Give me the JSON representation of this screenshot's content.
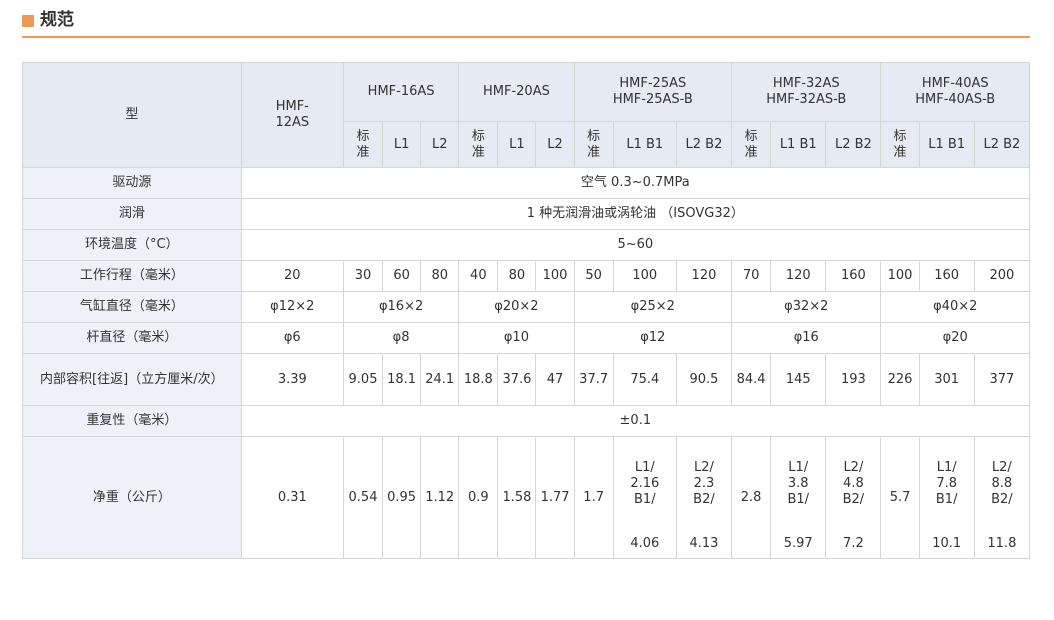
{
  "section": {
    "title": "规范"
  },
  "table": {
    "corner_label": "型",
    "models": [
      {
        "lines": [
          "HMF-",
          "12AS"
        ]
      },
      {
        "lines": [
          "HMF-16AS"
        ]
      },
      {
        "lines": [
          "HMF-20AS"
        ]
      },
      {
        "lines": [
          "HMF-25AS",
          "HMF-25AS-B"
        ]
      },
      {
        "lines": [
          "HMF-32AS",
          "HMF-32AS-B"
        ]
      },
      {
        "lines": [
          "HMF-40AS",
          "HMF-40AS-B"
        ]
      }
    ],
    "sub_headers": {
      "std": [
        "标",
        "准"
      ],
      "l1": "L1",
      "l2": "L2",
      "l1b1": "L1 B1",
      "l2b2": "L2 B2"
    },
    "rows": {
      "drive_source": {
        "label": "驱动源",
        "value": "空气 0.3~0.7MPa"
      },
      "lubrication": {
        "label": "润滑",
        "value": "1 种无润滑油或涡轮油 （ISOVG32）"
      },
      "ambient_temp": {
        "label": "环境温度（°C）",
        "value": "5~60"
      },
      "stroke": {
        "label": "工作行程（毫米）",
        "values": [
          "20",
          "30",
          "60",
          "80",
          "40",
          "80",
          "100",
          "50",
          "100",
          "120",
          "70",
          "120",
          "160",
          "100",
          "160",
          "200"
        ]
      },
      "bore": {
        "label": "气缸直径（毫米）",
        "values": [
          "φ12×2",
          "φ16×2",
          "φ20×2",
          "φ25×2",
          "φ32×2",
          "φ40×2"
        ]
      },
      "rod": {
        "label": "杆直径（毫米）",
        "values": [
          "φ6",
          "φ8",
          "φ10",
          "φ12",
          "φ16",
          "φ20"
        ]
      },
      "volume": {
        "label": "内部容积[往返]（立方厘米/次）",
        "values": [
          "3.39",
          "9.05",
          "18.1",
          "24.1",
          "18.8",
          "37.6",
          "47",
          "37.7",
          "75.4",
          "90.5",
          "84.4",
          "145",
          "193",
          "226",
          "301",
          "377"
        ]
      },
      "repeatability": {
        "label": "重复性（毫米）",
        "value": "±0.1"
      },
      "weight": {
        "label": "净重（公斤）",
        "simple": [
          "0.31",
          "0.54",
          "0.95",
          "1.12",
          "0.9",
          "1.58",
          "1.77",
          "1.7",
          "2.8",
          "5.7"
        ],
        "split": [
          {
            "lines": [
              "L1/",
              "2.16",
              "B1/"
            ],
            "bottom": "4.06"
          },
          {
            "lines": [
              "L2/",
              "2.3",
              "B2/"
            ],
            "bottom": "4.13"
          },
          {
            "lines": [
              "L1/",
              "3.8",
              "B1/"
            ],
            "bottom": "5.97"
          },
          {
            "lines": [
              "L2/",
              "4.8",
              "B2/"
            ],
            "bottom": "7.2"
          },
          {
            "lines": [
              "L1/",
              "7.8",
              "B1/"
            ],
            "bottom": "10.1"
          },
          {
            "lines": [
              "L2/",
              "8.8",
              "B2/"
            ],
            "bottom": "11.8"
          }
        ]
      }
    }
  }
}
